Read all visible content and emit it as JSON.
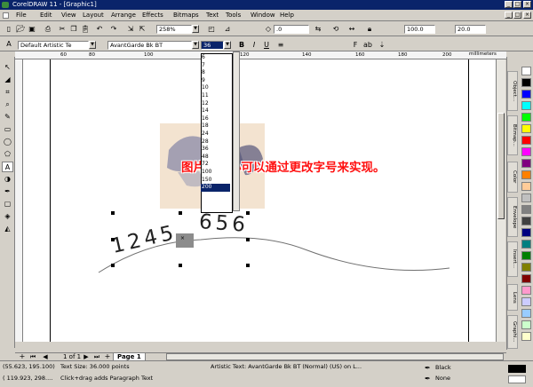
{
  "window": {
    "title": "CorelDRAW 11 - [Graphic1]"
  },
  "menu": [
    "File",
    "Edit",
    "View",
    "Layout",
    "Arrange",
    "Effects",
    "Bitmaps",
    "Text",
    "Tools",
    "Window",
    "Help"
  ],
  "toolbar": {
    "zoom": "258%",
    "outline": ".0",
    "size_w": "100.0",
    "size_h": "20.0"
  },
  "propbar": {
    "style": "Default Artistic Te",
    "font": "AvantGarde Bk BT",
    "size": "36"
  },
  "font_size_options": [
    "6",
    "7",
    "8",
    "9",
    "10",
    "11",
    "12",
    "14",
    "16",
    "18",
    "24",
    "28",
    "36",
    "48",
    "72",
    "100",
    "150",
    "200"
  ],
  "font_size_selected": "200",
  "ruler_top": [
    "60",
    "80",
    "100",
    "120",
    "140",
    "160",
    "180",
    "200"
  ],
  "ruler_unit": "millimeters",
  "ruler_left": [
    "260",
    "240",
    "220",
    "200",
    "180",
    "160"
  ],
  "canvas": {
    "annotation": "图片的大小可以通过更改字号来实现。",
    "path_text_a": "1245",
    "path_text_b": "656"
  },
  "pages": {
    "counter": "1 of 1",
    "tab": "Page 1"
  },
  "status": {
    "coords": "(55.623, 195.100)",
    "text_size": "Text Size: 36.000 points",
    "object": "Artistic Text: AvantGarde Bk BT (Normal) (US) on L...",
    "coords2": "( 119.923, 298....",
    "hint": "Click+drag adds Paragraph Text",
    "fill": "Black",
    "outline": "None"
  },
  "dockers": [
    "Object...",
    "Bitmap...",
    "Color",
    "Envelope",
    "Insert...",
    "Lens",
    "Graphi..."
  ],
  "palette_colors": [
    "#ffffff",
    "#000000",
    "#0000ff",
    "#00ffff",
    "#00ff00",
    "#ffff00",
    "#ff0000",
    "#ff00ff",
    "#800080",
    "#ff8000",
    "#ffcc99",
    "#c0c0c0",
    "#808080",
    "#404040",
    "#000080",
    "#008080",
    "#008000",
    "#808000",
    "#800000",
    "#ff99cc",
    "#ccccff",
    "#99ccff",
    "#ccffcc",
    "#ffffcc"
  ]
}
